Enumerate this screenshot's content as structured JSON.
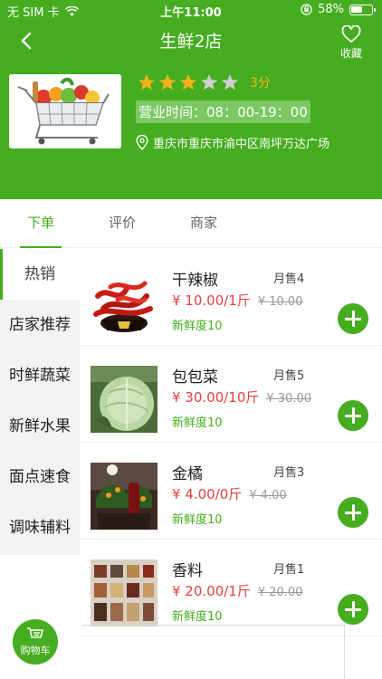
{
  "status_bar": {
    "carrier": "无 SIM 卡",
    "time": "上午11:00",
    "battery": "58%",
    "battery_level": 0.58
  },
  "header": {
    "title": "生鲜2店",
    "favorite_label": "收藏",
    "rating": 3,
    "max_rating": 5,
    "score_text": "3分",
    "hours": "营业时间：08：00-19：00",
    "address": "重庆市重庆市渝中区南坪万达广场"
  },
  "tabs": [
    "下单",
    "评价",
    "商家"
  ],
  "categories": [
    "热销",
    "店家推荐",
    "时鲜蔬菜",
    "新鲜水果",
    "面点速食",
    "调味辅料"
  ],
  "products": [
    {
      "name": "干辣椒",
      "sold": "月售4",
      "price": "¥ 10.00/1斤",
      "old_price": "¥ 10.00",
      "freshness": "新鲜度10"
    },
    {
      "name": "包包菜",
      "sold": "月售5",
      "price": "¥ 30.00/10斤",
      "old_price": "¥ 30.00",
      "freshness": "新鲜度10"
    },
    {
      "name": "金橘",
      "sold": "月售3",
      "price": "¥ 4.00/0斤",
      "old_price": "¥ 4.00",
      "freshness": "新鲜度10"
    },
    {
      "name": "香料",
      "sold": "月售1",
      "price": "¥ 20.00/1斤",
      "old_price": "¥ 20.00",
      "freshness": "新鲜度10"
    }
  ],
  "cart": {
    "label": "购物车"
  },
  "colors": {
    "brand": "#45ad1f",
    "price": "#e64040",
    "star": "#f5b31a",
    "star_empty": "#cfcfcf"
  }
}
